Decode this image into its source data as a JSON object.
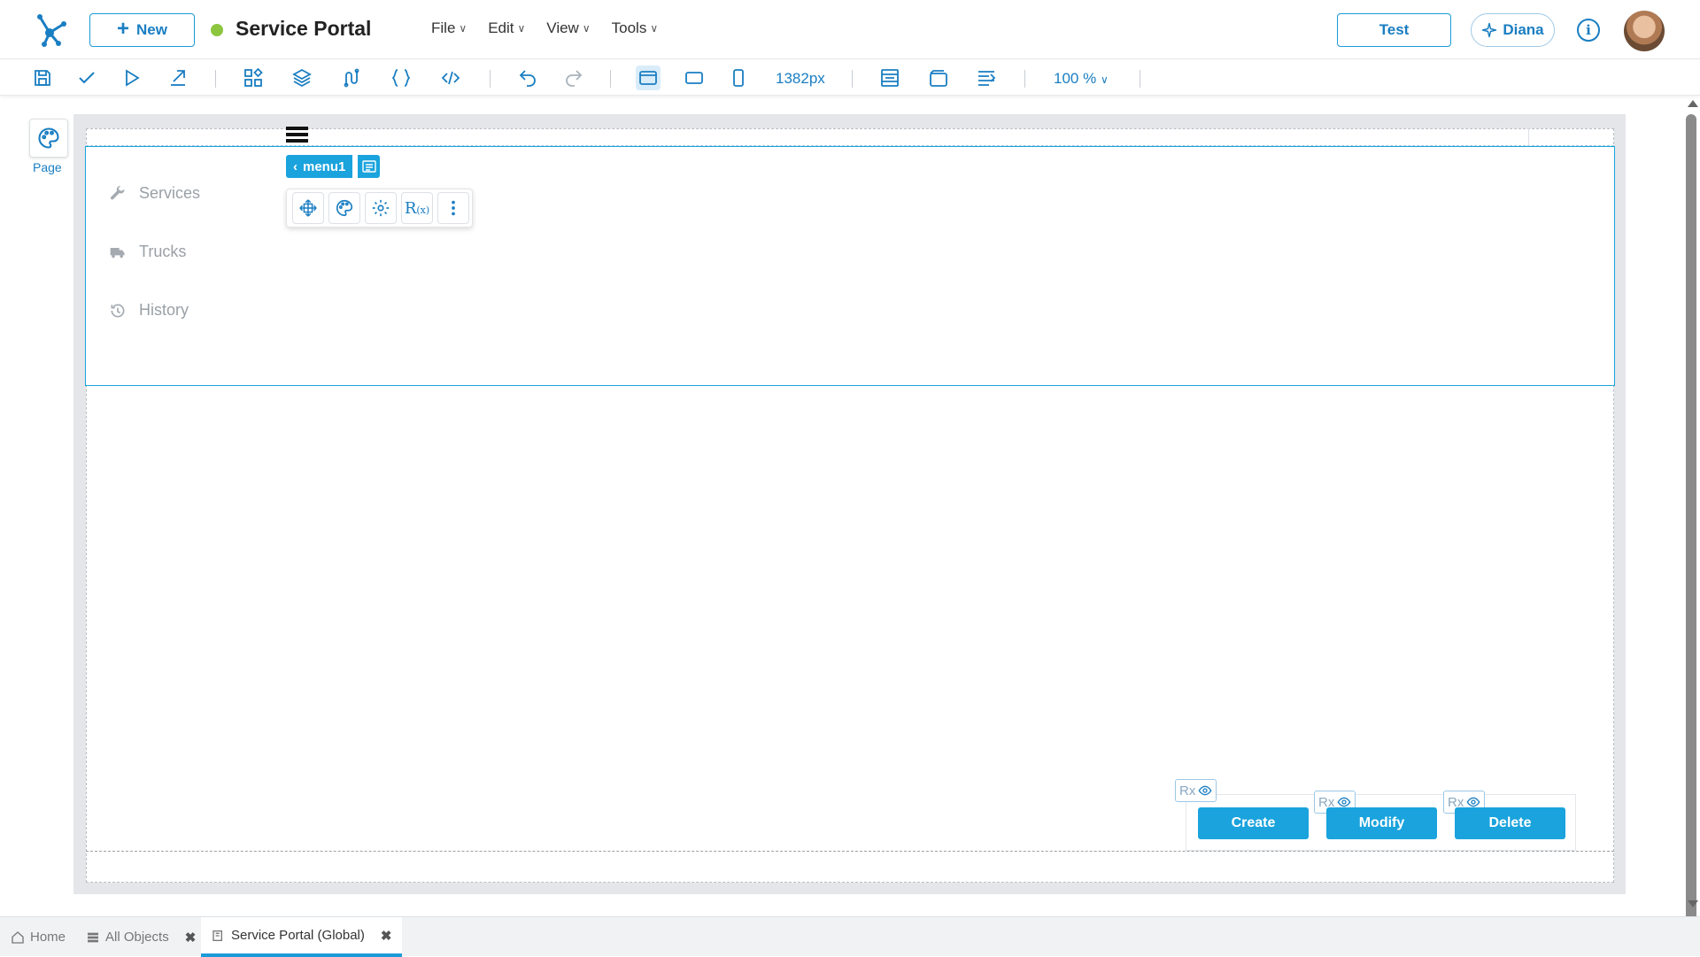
{
  "header": {
    "new_label": "New",
    "app_title": "Service Portal",
    "status_color": "#8cc63f",
    "menus": [
      "File",
      "Edit",
      "View",
      "Tools"
    ],
    "test_label": "Test",
    "assistant_label": "Diana"
  },
  "toolbar": {
    "width_readout": "1382px",
    "zoom": "100 %"
  },
  "rail": {
    "page_label": "Page"
  },
  "canvas": {
    "component_tag": "menu1",
    "menu_items": [
      {
        "label": "Services",
        "icon": "wrench-icon"
      },
      {
        "label": "Trucks",
        "icon": "truck-icon"
      },
      {
        "label": "History",
        "icon": "history-icon"
      }
    ],
    "buttons": [
      "Create",
      "Modify",
      "Delete"
    ],
    "rx_badge": "Rx"
  },
  "bottom_tabs": [
    {
      "label": "Home",
      "icon": "home-icon"
    },
    {
      "label": "All Objects",
      "icon": "list-icon"
    },
    {
      "label": "Service Portal (Global)",
      "icon": "page-icon"
    }
  ],
  "colors": {
    "accent": "#1aa3dd",
    "brand": "#1a7ec2"
  }
}
